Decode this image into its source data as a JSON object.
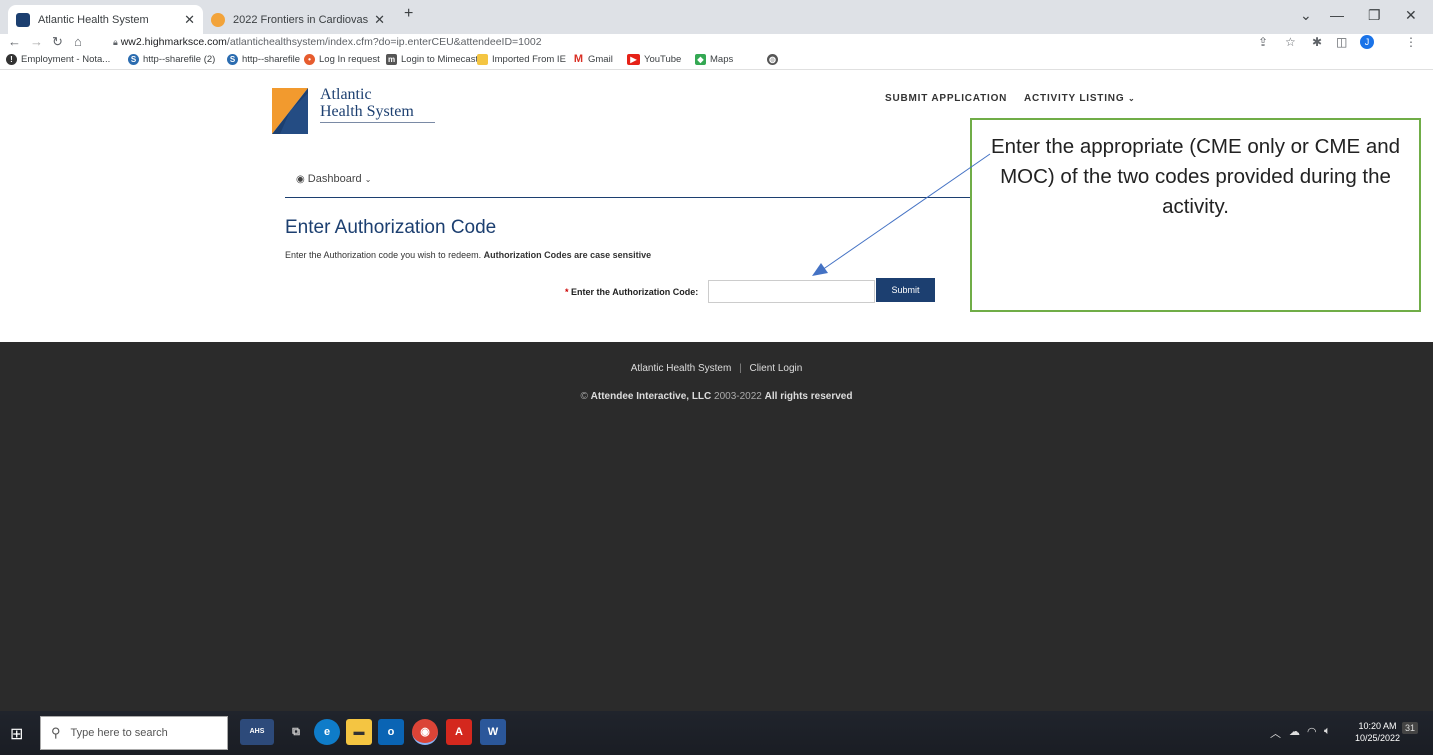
{
  "browser": {
    "tabs": [
      {
        "title": "Atlantic Health System",
        "active": true
      },
      {
        "title": "2022 Frontiers in Cardiovascular",
        "active": false
      }
    ],
    "new_tab": "+",
    "url_host": "ww2.highmarksce.com",
    "url_path": "/atlantichealthsystem/index.cfm?do=ip.enterCEU&attendeeID=1002",
    "profile_initial": "J",
    "bookmarks": [
      {
        "label": "Employment - Nota...",
        "icon": "employment-icon"
      },
      {
        "label": "http--sharefile (2)",
        "icon": "sharefile-icon"
      },
      {
        "label": "http--sharefile",
        "icon": "sharefile-icon"
      },
      {
        "label": "Log In request",
        "icon": "login-request-icon"
      },
      {
        "label": "Login to Mimecast",
        "icon": "mimecast-icon"
      },
      {
        "label": "Imported From IE",
        "icon": "folder-icon"
      },
      {
        "label": "Gmail",
        "icon": "gmail-icon"
      },
      {
        "label": "YouTube",
        "icon": "youtube-icon"
      },
      {
        "label": "Maps",
        "icon": "maps-icon"
      }
    ]
  },
  "site": {
    "logo_line1": "Atlantic",
    "logo_line2": "Health System",
    "nav": {
      "submit_application": "SUBMIT APPLICATION",
      "activity_listing": "ACTIVITY LISTING",
      "caret": "⌄"
    },
    "dashboard": "Dashboard",
    "title": "Enter Authorization Code",
    "instructions": "Enter the Authorization code you wish to redeem. ",
    "instructions_bold": "Authorization Codes are case sensitive",
    "field_required": "*",
    "field_label": "Enter the Authorization Code:",
    "input_value": "",
    "submit": "Submit"
  },
  "callout": {
    "text": "Enter the appropriate (CME only or CME and MOC) of the two codes provided during the activity."
  },
  "footer": {
    "org": "Atlantic Health System",
    "separator": "|",
    "client_login": "Client Login",
    "copyright_prefix": "©",
    "company": "Attendee Interactive, LLC",
    "years": "2003-2022",
    "rights": "All rights reserved"
  },
  "taskbar": {
    "search_placeholder": "Type here to search",
    "time": "10:20 AM",
    "date": "10/25/2022",
    "notification_count": "31"
  },
  "colors": {
    "brand_navy": "#1c3f70",
    "callout_border": "#70ad47",
    "footer_bg": "#2b2b2b"
  }
}
